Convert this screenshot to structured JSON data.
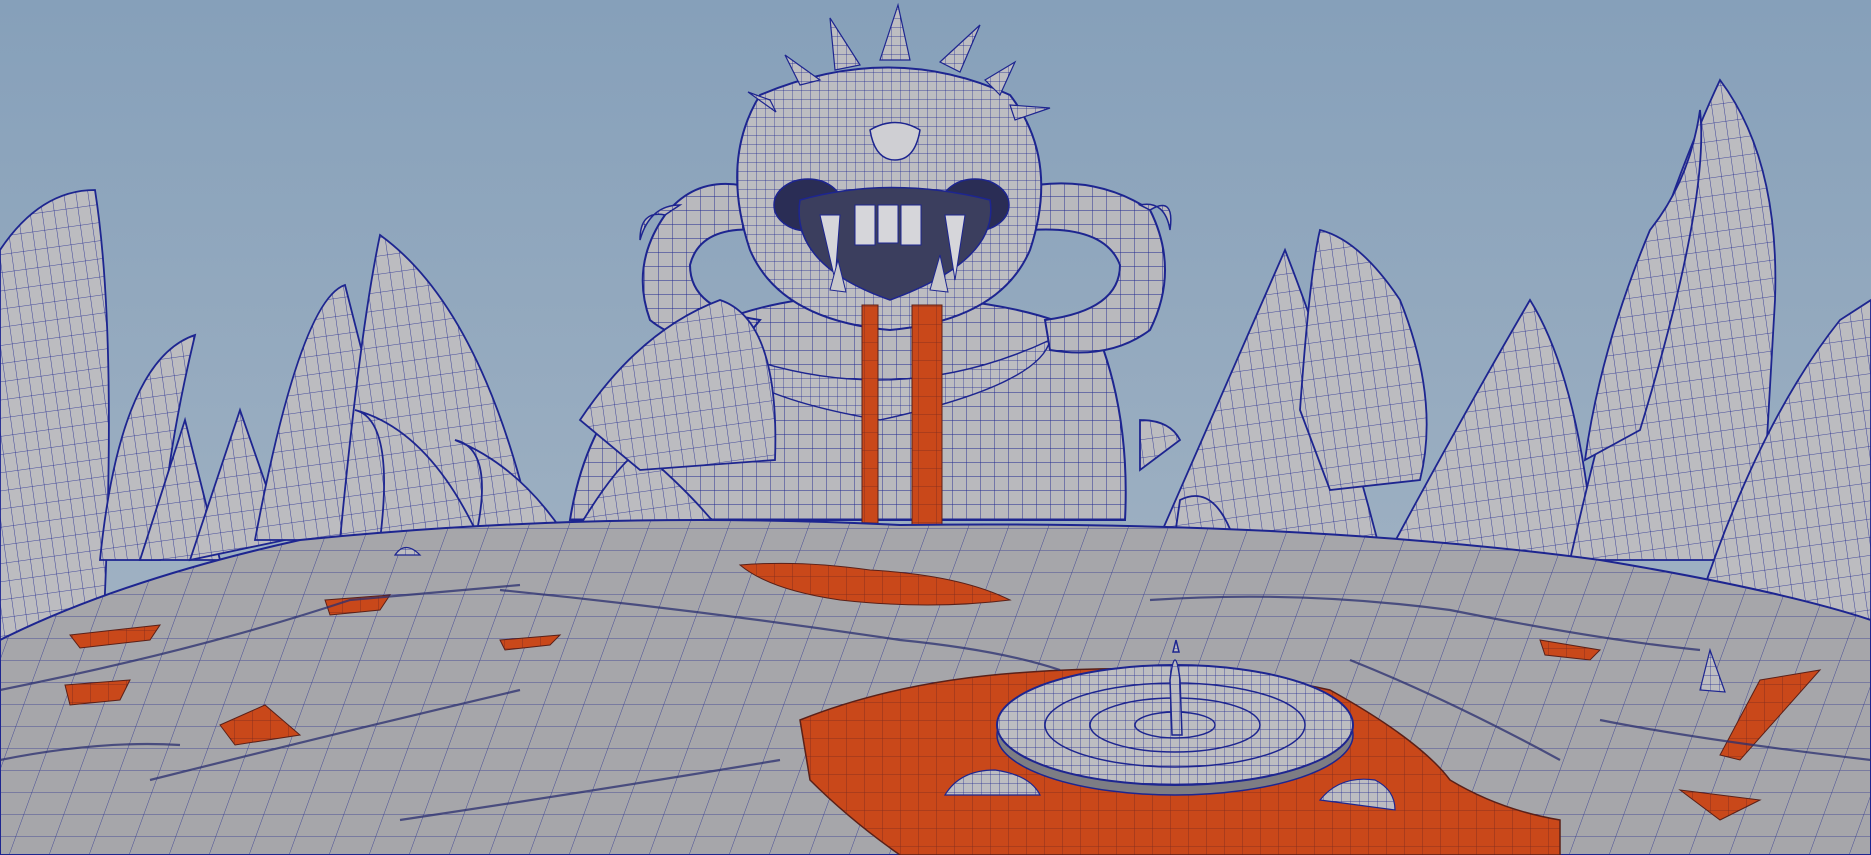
{
  "scene": {
    "colors": {
      "sky_top": "#86a0ba",
      "sky_bottom": "#a9b8c6",
      "mesh_fill": "#b8b8bc",
      "mesh_fill_dark": "#8f9096",
      "wire": "#1a1f8a",
      "lava": "#b8400f",
      "lava_bright": "#d4501a",
      "shadow": "#2a2c40"
    },
    "objects": [
      "skull-statue",
      "lava-waterfall",
      "rock-spires-left",
      "rock-spires-right",
      "cracked-ground",
      "lava-pool",
      "central-platform",
      "center-pillar"
    ]
  }
}
